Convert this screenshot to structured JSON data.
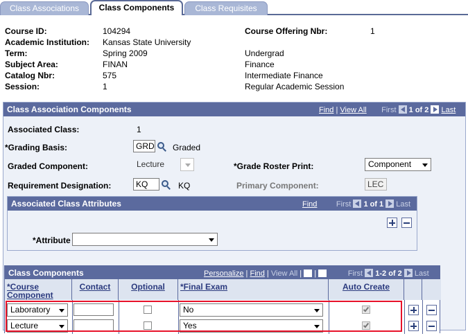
{
  "tabs": [
    {
      "label": "Class Associations",
      "active": false
    },
    {
      "label": "Class Components",
      "active": true
    },
    {
      "label": "Class Requisites",
      "active": false
    }
  ],
  "header": {
    "course_id_label": "Course ID:",
    "course_id": "104294",
    "course_offering_nbr_label": "Course Offering Nbr:",
    "course_offering_nbr": "1",
    "institution_label": "Academic Institution:",
    "institution": "Kansas State University",
    "term_label": "Term:",
    "term": "Spring 2009",
    "career": "Undergrad",
    "subject_label": "Subject Area:",
    "subject": "FINAN",
    "subject_desc": "Finance",
    "catalog_label": "Catalog Nbr:",
    "catalog": "575",
    "catalog_desc": "Intermediate Finance",
    "session_label": "Session:",
    "session": "1",
    "session_desc": "Regular Academic Session"
  },
  "assoc_panel": {
    "title": "Class Association Components",
    "nav": {
      "find": "Find",
      "sep": "|",
      "view_all": "View All",
      "first": "First",
      "count": "1 of 2",
      "last": "Last"
    },
    "associated_class_label": "Associated Class:",
    "associated_class": "1",
    "grading_basis_label": "*Grading Basis:",
    "grading_basis": "GRD",
    "grading_basis_desc": "Graded",
    "graded_component_label": "Graded Component:",
    "graded_component": "Lecture",
    "grade_roster_label": "*Grade Roster Print:",
    "grade_roster": "Component",
    "requirement_label": "Requirement Designation:",
    "requirement": "KQ",
    "requirement_desc": "KQ",
    "primary_component_label": "Primary Component:",
    "primary_component": "LEC"
  },
  "attr_panel": {
    "title": "Associated Class Attributes",
    "nav": {
      "find": "Find",
      "first": "First",
      "count": "1 of 1",
      "last": "Last"
    },
    "attribute_label": "*Attribute",
    "attribute_value": ""
  },
  "components_grid": {
    "title": "Class Components",
    "nav": {
      "personalize": "Personalize",
      "find": "Find",
      "view_all": "View All",
      "first": "First",
      "count": "1-2 of 2",
      "last": "Last"
    },
    "columns": {
      "course_component": "*Course Component",
      "contact": "Contact",
      "optional": "Optional",
      "final_exam": "*Final Exam",
      "auto_create": "Auto Create"
    },
    "rows": [
      {
        "component": "Laboratory",
        "contact": "",
        "optional": false,
        "final_exam": "No",
        "auto_create": true
      },
      {
        "component": "Lecture",
        "contact": "",
        "optional": false,
        "final_exam": "Yes",
        "auto_create": true
      }
    ]
  },
  "colors": {
    "panel_header": "#5b6a9e",
    "panel_bg": "#edf1f8",
    "highlight": "#e8122a",
    "link": "#2b3a7e"
  }
}
